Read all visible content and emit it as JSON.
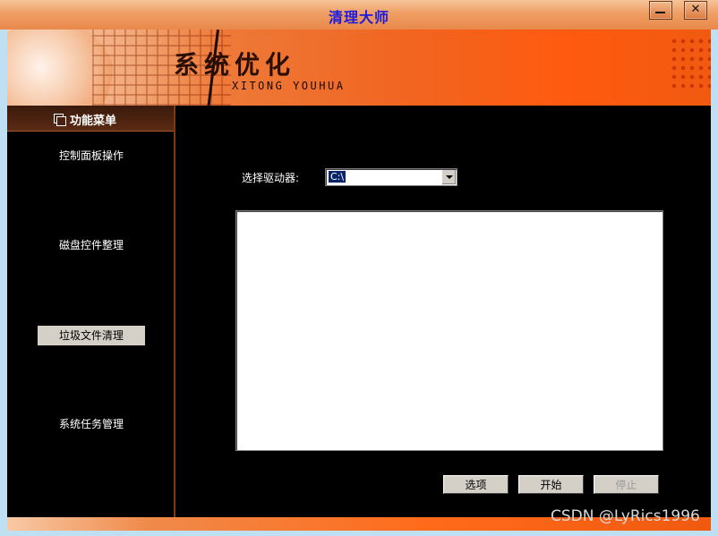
{
  "window": {
    "title": "清理大师"
  },
  "titlebar_buttons": {
    "minimize_icon": "minimize-icon",
    "close_glyph": "✕"
  },
  "banner": {
    "title": "系统优化",
    "subtitle": "XITONG YOUHUA"
  },
  "sidebar": {
    "header_label": "功能菜单",
    "items": [
      {
        "label": "控制面板操作",
        "active": false
      },
      {
        "label": "磁盘控件整理",
        "active": false
      },
      {
        "label": "垃圾文件清理",
        "active": true
      },
      {
        "label": "系统任务管理",
        "active": false
      }
    ]
  },
  "content": {
    "drive_label": "选择驱动器:",
    "drive_value": "C:\\",
    "buttons": {
      "options": "选项",
      "start": "开始",
      "stop": "停止"
    }
  },
  "watermark": "CSDN @LyRics1996",
  "colors": {
    "title_text": "#1a1ae0",
    "banner_orange": "#f06622",
    "background": "#000000",
    "selection": "#0a246a"
  }
}
